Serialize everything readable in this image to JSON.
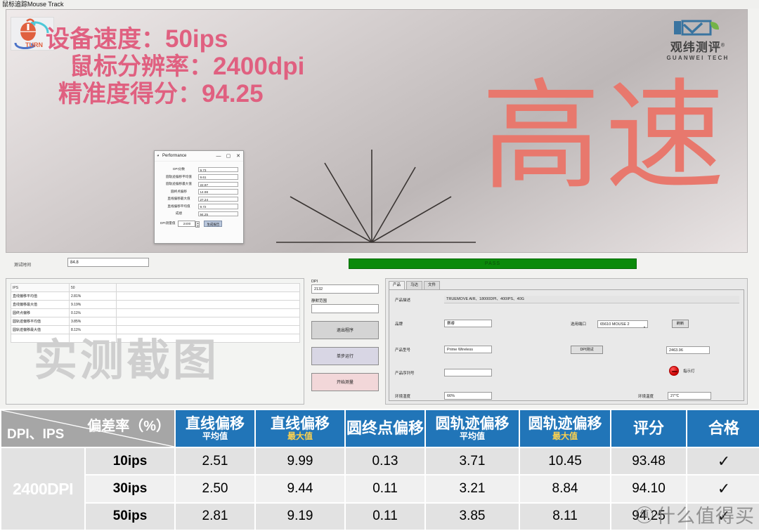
{
  "window": {
    "title": "鼠标追踪Mouse Track"
  },
  "canvas": {
    "brand_logo_text": "TURN",
    "headline": {
      "line1_label": "设备速度：",
      "line1_value": "50ips",
      "line2_label": "鼠标分辨率：",
      "line2_value": "2400dpi",
      "line3_label": "精准度得分：",
      "line3_value": "94.25"
    },
    "big_word": "高速",
    "company_logo": {
      "cn": "观纬测评",
      "en": "GUANWEI TECH",
      "registered": "®"
    }
  },
  "performance_dialog": {
    "title": "Performance",
    "icon": "app-icon",
    "minimize": "—",
    "maximize": "▢",
    "close": "✕",
    "rows": [
      {
        "label": "DPI分数",
        "value": "9.73"
      },
      {
        "label": "圆轨迹偏移平均值",
        "value": "9.61"
      },
      {
        "label": "圆轨迹偏移最大值",
        "value": "22.97"
      },
      {
        "label": "圆终点偏移",
        "value": "14.98"
      },
      {
        "label": "直线偏移最大值",
        "value": "27.24"
      },
      {
        "label": "直线偏移平均值",
        "value": "9.72"
      },
      {
        "label": "成绩",
        "value": "94.25"
      }
    ],
    "footer": {
      "label": "DPI测量值",
      "spin_value": "2400",
      "spin_up": "▲",
      "spin_down": "▼",
      "button": "生成报告"
    }
  },
  "test_strip": {
    "time_label": "测试时间",
    "time_value": "84.8",
    "pass_text": "PASS"
  },
  "left_panel": {
    "watermark": "实测截图",
    "grid": {
      "header": [
        "IPS",
        "50",
        ""
      ],
      "rows": [
        [
          "直线偏移平均值",
          "2.81%",
          ""
        ],
        [
          "直线偏移最大值",
          "9.19%",
          ""
        ],
        [
          "圆终点偏移",
          "0.11%",
          ""
        ],
        [
          "圆轨迹偏移平均值",
          "3.85%",
          ""
        ],
        [
          "圆轨迹偏移最大值",
          "8.11%",
          ""
        ],
        [
          "",
          "",
          ""
        ]
      ]
    }
  },
  "middle_panel": {
    "dpi_label": "DPI",
    "dpi_value": "2132",
    "silence_label": "静默范围",
    "silence_value": "",
    "exit_button": "退出程序",
    "step_button": "单步运行",
    "start_button": "开始测量"
  },
  "right_panel": {
    "tabs": [
      {
        "label": "产品",
        "active": true
      },
      {
        "label": "马达",
        "active": false
      },
      {
        "label": "文件",
        "active": false
      }
    ],
    "fields": {
      "desc_label": "产品描述",
      "desc_value": "TRUEMOVE AIR、18000DPI、400IPS、40G",
      "brand_label": "品牌",
      "brand_value": "赛睿",
      "model_label": "产品型号",
      "model_value": "Prime Wireless",
      "serial_label": "产品序列号",
      "serial_value": "",
      "humidity_label": "环境湿度",
      "humidity_value": "66%",
      "port_label": "选用端口",
      "port_value": "65610  MOUSE 2",
      "port_caret": "▾",
      "refresh_button": "刷新",
      "dpi_test_button": "DPI测试",
      "dpi_test_value": "2463.96",
      "led_label": "指示灯",
      "temp_label": "环境温度",
      "temp_value": "27℃"
    }
  },
  "summary_table": {
    "corner_top": "偏差率（%）",
    "corner_bottom": "DPI、IPS",
    "columns": [
      {
        "main": "直线偏移",
        "sub": "平均值",
        "sub_gold": false
      },
      {
        "main": "直线偏移",
        "sub": "最大值",
        "sub_gold": true
      },
      {
        "main": "圆终点偏移",
        "sub": "",
        "sub_gold": false
      },
      {
        "main": "圆轨迹偏移",
        "sub": "平均值",
        "sub_gold": false
      },
      {
        "main": "圆轨迹偏移",
        "sub": "最大值",
        "sub_gold": true
      },
      {
        "main": "评分",
        "sub": "",
        "sub_gold": false
      },
      {
        "main": "合格",
        "sub": "",
        "sub_gold": false
      }
    ],
    "dpi_group": "2400DPI",
    "rows": [
      {
        "ips": "10ips",
        "line_avg": "2.51",
        "line_max": "9.99",
        "circle_end": "0.13",
        "circle_avg": "3.71",
        "circle_max": "10.45",
        "score": "93.48",
        "pass": "✓"
      },
      {
        "ips": "30ips",
        "line_avg": "2.50",
        "line_max": "9.44",
        "circle_end": "0.11",
        "circle_avg": "3.21",
        "circle_max": "8.84",
        "score": "94.10",
        "pass": "✓"
      },
      {
        "ips": "50ips",
        "line_avg": "2.81",
        "line_max": "9.19",
        "circle_end": "0.11",
        "circle_avg": "3.85",
        "circle_max": "8.11",
        "score": "94.25",
        "pass": "✓"
      }
    ],
    "watermark": {
      "mark": "值",
      "text": "什么值得买"
    }
  },
  "colors": {
    "accent_pink": "#e06080",
    "header_blue": "#2175b8",
    "dpi_green": "#6aa84f",
    "pass_green": "#0b8a0b",
    "gold": "#ffd24d"
  }
}
